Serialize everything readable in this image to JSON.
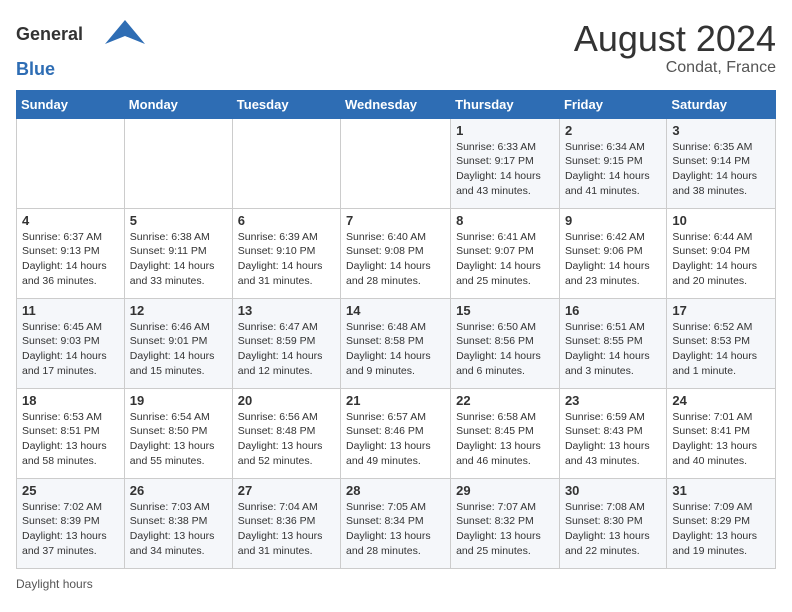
{
  "header": {
    "logo_general": "General",
    "logo_blue": "Blue",
    "month_year": "August 2024",
    "location": "Condat, France"
  },
  "days_of_week": [
    "Sunday",
    "Monday",
    "Tuesday",
    "Wednesday",
    "Thursday",
    "Friday",
    "Saturday"
  ],
  "weeks": [
    [
      {
        "day": "",
        "info": ""
      },
      {
        "day": "",
        "info": ""
      },
      {
        "day": "",
        "info": ""
      },
      {
        "day": "",
        "info": ""
      },
      {
        "day": "1",
        "sunrise": "6:33 AM",
        "sunset": "9:17 PM",
        "daylight": "14 hours and 43 minutes."
      },
      {
        "day": "2",
        "sunrise": "6:34 AM",
        "sunset": "9:15 PM",
        "daylight": "14 hours and 41 minutes."
      },
      {
        "day": "3",
        "sunrise": "6:35 AM",
        "sunset": "9:14 PM",
        "daylight": "14 hours and 38 minutes."
      }
    ],
    [
      {
        "day": "4",
        "sunrise": "6:37 AM",
        "sunset": "9:13 PM",
        "daylight": "14 hours and 36 minutes."
      },
      {
        "day": "5",
        "sunrise": "6:38 AM",
        "sunset": "9:11 PM",
        "daylight": "14 hours and 33 minutes."
      },
      {
        "day": "6",
        "sunrise": "6:39 AM",
        "sunset": "9:10 PM",
        "daylight": "14 hours and 31 minutes."
      },
      {
        "day": "7",
        "sunrise": "6:40 AM",
        "sunset": "9:08 PM",
        "daylight": "14 hours and 28 minutes."
      },
      {
        "day": "8",
        "sunrise": "6:41 AM",
        "sunset": "9:07 PM",
        "daylight": "14 hours and 25 minutes."
      },
      {
        "day": "9",
        "sunrise": "6:42 AM",
        "sunset": "9:06 PM",
        "daylight": "14 hours and 23 minutes."
      },
      {
        "day": "10",
        "sunrise": "6:44 AM",
        "sunset": "9:04 PM",
        "daylight": "14 hours and 20 minutes."
      }
    ],
    [
      {
        "day": "11",
        "sunrise": "6:45 AM",
        "sunset": "9:03 PM",
        "daylight": "14 hours and 17 minutes."
      },
      {
        "day": "12",
        "sunrise": "6:46 AM",
        "sunset": "9:01 PM",
        "daylight": "14 hours and 15 minutes."
      },
      {
        "day": "13",
        "sunrise": "6:47 AM",
        "sunset": "8:59 PM",
        "daylight": "14 hours and 12 minutes."
      },
      {
        "day": "14",
        "sunrise": "6:48 AM",
        "sunset": "8:58 PM",
        "daylight": "14 hours and 9 minutes."
      },
      {
        "day": "15",
        "sunrise": "6:50 AM",
        "sunset": "8:56 PM",
        "daylight": "14 hours and 6 minutes."
      },
      {
        "day": "16",
        "sunrise": "6:51 AM",
        "sunset": "8:55 PM",
        "daylight": "14 hours and 3 minutes."
      },
      {
        "day": "17",
        "sunrise": "6:52 AM",
        "sunset": "8:53 PM",
        "daylight": "14 hours and 1 minute."
      }
    ],
    [
      {
        "day": "18",
        "sunrise": "6:53 AM",
        "sunset": "8:51 PM",
        "daylight": "13 hours and 58 minutes."
      },
      {
        "day": "19",
        "sunrise": "6:54 AM",
        "sunset": "8:50 PM",
        "daylight": "13 hours and 55 minutes."
      },
      {
        "day": "20",
        "sunrise": "6:56 AM",
        "sunset": "8:48 PM",
        "daylight": "13 hours and 52 minutes."
      },
      {
        "day": "21",
        "sunrise": "6:57 AM",
        "sunset": "8:46 PM",
        "daylight": "13 hours and 49 minutes."
      },
      {
        "day": "22",
        "sunrise": "6:58 AM",
        "sunset": "8:45 PM",
        "daylight": "13 hours and 46 minutes."
      },
      {
        "day": "23",
        "sunrise": "6:59 AM",
        "sunset": "8:43 PM",
        "daylight": "13 hours and 43 minutes."
      },
      {
        "day": "24",
        "sunrise": "7:01 AM",
        "sunset": "8:41 PM",
        "daylight": "13 hours and 40 minutes."
      }
    ],
    [
      {
        "day": "25",
        "sunrise": "7:02 AM",
        "sunset": "8:39 PM",
        "daylight": "13 hours and 37 minutes."
      },
      {
        "day": "26",
        "sunrise": "7:03 AM",
        "sunset": "8:38 PM",
        "daylight": "13 hours and 34 minutes."
      },
      {
        "day": "27",
        "sunrise": "7:04 AM",
        "sunset": "8:36 PM",
        "daylight": "13 hours and 31 minutes."
      },
      {
        "day": "28",
        "sunrise": "7:05 AM",
        "sunset": "8:34 PM",
        "daylight": "13 hours and 28 minutes."
      },
      {
        "day": "29",
        "sunrise": "7:07 AM",
        "sunset": "8:32 PM",
        "daylight": "13 hours and 25 minutes."
      },
      {
        "day": "30",
        "sunrise": "7:08 AM",
        "sunset": "8:30 PM",
        "daylight": "13 hours and 22 minutes."
      },
      {
        "day": "31",
        "sunrise": "7:09 AM",
        "sunset": "8:29 PM",
        "daylight": "13 hours and 19 minutes."
      }
    ]
  ],
  "footer": {
    "daylight_label": "Daylight hours"
  }
}
